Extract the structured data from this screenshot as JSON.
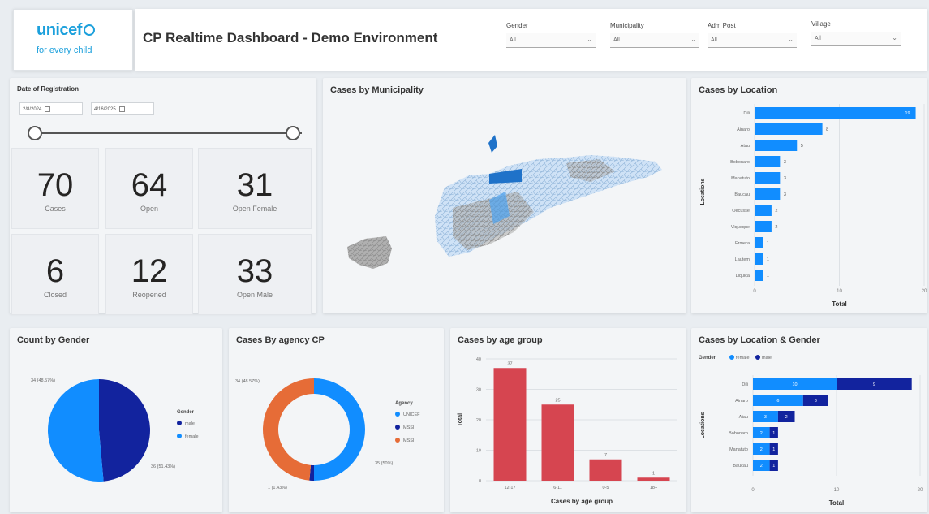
{
  "header": {
    "logo_main": "unicef",
    "logo_sub": "for every child",
    "title": "CP Realtime Dashboard - Demo Environment",
    "filters": [
      {
        "label": "Gender",
        "value": "All"
      },
      {
        "label": "Municipality",
        "value": "All"
      },
      {
        "label": "Adm Post",
        "value": "All"
      },
      {
        "label": "Village",
        "value": "All"
      }
    ]
  },
  "date_filter": {
    "title": "Date of Registration",
    "start": "2/8/2024",
    "end": "4/16/2025"
  },
  "kpis": [
    {
      "value": "70",
      "label": "Cases"
    },
    {
      "value": "64",
      "label": "Open"
    },
    {
      "value": "31",
      "label": "Open Female"
    },
    {
      "value": "6",
      "label": "Closed"
    },
    {
      "value": "12",
      "label": "Reopened"
    },
    {
      "value": "33",
      "label": "Open Male"
    }
  ],
  "map": {
    "title": "Cases by Municipality"
  },
  "colors": {
    "blue": "#118dff",
    "navy": "#12239e",
    "orange": "#e66c37",
    "red": "#d64550",
    "panel": "#f3f5f7"
  },
  "chart_data": [
    {
      "id": "loc",
      "type": "bar",
      "orientation": "horizontal",
      "title": "Cases by Location",
      "categories": [
        "Dili",
        "Ainaro",
        "Atau",
        "Bobonaro",
        "Manatuto",
        "Baucau",
        "Oecusse",
        "Viqueque",
        "Ermera",
        "Lautem",
        "Liquiça"
      ],
      "values": [
        19,
        8,
        5,
        3,
        3,
        3,
        2,
        2,
        1,
        1,
        1
      ],
      "xlabel": "Total",
      "ylabel": "Locations",
      "xlim": [
        0,
        20
      ],
      "xticks": [
        "0",
        "10",
        "20"
      ]
    },
    {
      "id": "gender",
      "type": "pie",
      "title": "Count by Gender",
      "legend_title": "Gender",
      "labels": [
        "male",
        "female"
      ],
      "values": [
        34,
        36
      ],
      "data_labels": [
        "34 (48.57%)",
        "36 (51.43%)"
      ],
      "colors": [
        "#12239e",
        "#118dff"
      ]
    },
    {
      "id": "agency",
      "type": "pie",
      "title": "Cases By agency CP",
      "legend_title": "Agency",
      "labels": [
        "UNICEF",
        "MSSI",
        "MSSI"
      ],
      "values": [
        35,
        1,
        34
      ],
      "data_labels": [
        "35 (50%)",
        "1 (1.43%)",
        "34 (48.57%)"
      ],
      "colors": [
        "#118dff",
        "#12239e",
        "#e66c37"
      ]
    },
    {
      "id": "age",
      "type": "bar",
      "title": "Cases by age group",
      "categories": [
        "12-17",
        "6-11",
        "0-5",
        "18+"
      ],
      "values": [
        37,
        25,
        7,
        1
      ],
      "xlabel": "Cases by age group",
      "ylabel": "Total",
      "ylim": [
        0,
        40
      ],
      "yticks": [
        "0",
        "10",
        "20",
        "30",
        "40"
      ]
    },
    {
      "id": "locg",
      "type": "bar",
      "orientation": "horizontal",
      "stacked": true,
      "title": "Cases by Location & Gender",
      "legend_title": "Gender",
      "categories": [
        "Dili",
        "Ainaro",
        "Atau",
        "Bobonaro",
        "Manatuto",
        "Baucau"
      ],
      "series": [
        {
          "name": "female",
          "values": [
            10,
            6,
            3,
            2,
            2,
            2
          ]
        },
        {
          "name": "male",
          "values": [
            9,
            3,
            2,
            1,
            1,
            1
          ]
        }
      ],
      "xlabel": "Total",
      "ylabel": "Locations",
      "xlim": [
        0,
        20
      ],
      "xticks": [
        "0",
        "10",
        "20"
      ]
    }
  ]
}
